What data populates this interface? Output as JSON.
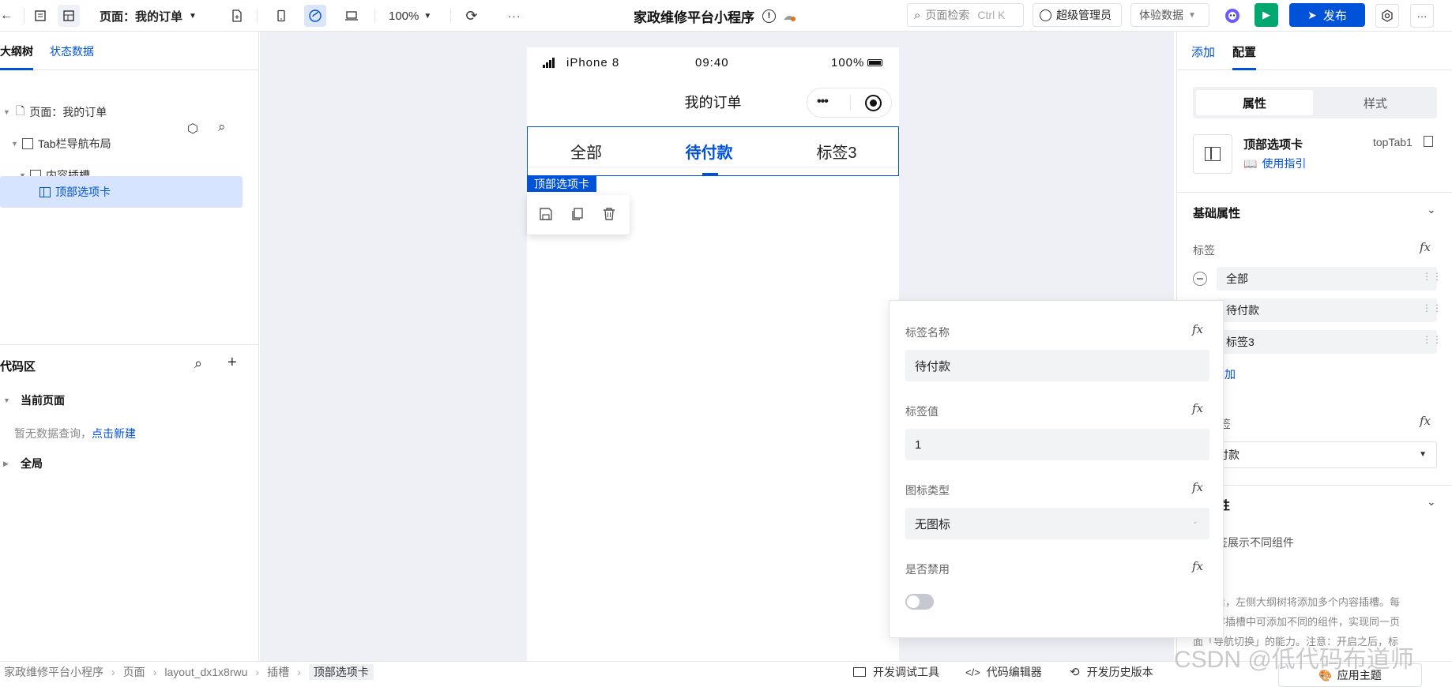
{
  "topbar": {
    "page_select": "页面：我的订单",
    "zoom": "100%",
    "more": "···",
    "app_title": "家政维修平台小程序",
    "search_placeholder": "页面检索",
    "search_shortcut": "Ctrl K",
    "user": "超级管理员",
    "data_mode": "体验数据",
    "publish": "发布"
  },
  "left": {
    "tabs": [
      "大纲树",
      "状态数据"
    ],
    "tree": [
      "页面：我的订单",
      "Tab栏导航布局",
      "内容插槽",
      "顶部选项卡"
    ],
    "code_title": "代码区",
    "current_page": "当前页面",
    "empty_text": "暂无数据查询，",
    "new_link": "点击新建",
    "global": "全局"
  },
  "phone": {
    "carrier": "iPhone 8",
    "time": "09:40",
    "battery": "100%",
    "title": "我的订单",
    "tabs": [
      "全部",
      "待付款",
      "标签3"
    ],
    "selection_label": "顶部选项卡"
  },
  "popup": {
    "name_label": "标签名称",
    "name_value": "待付款",
    "value_label": "标签值",
    "value_value": "1",
    "icon_label": "图标类型",
    "icon_value": "无图标",
    "disabled_label": "是否禁用"
  },
  "right": {
    "tabs": [
      "添加",
      "配置"
    ],
    "seg": [
      "属性",
      "样式"
    ],
    "comp_name": "顶部选项卡",
    "comp_id": "topTab1",
    "guide": "使用指引",
    "basic_section": "基础属性",
    "tags_label": "标签",
    "tag_items": [
      "全部",
      "待付款",
      "标签3"
    ],
    "add_text": "添加",
    "default_label": "标签",
    "default_value": "付款",
    "adv_section": "性",
    "adv_line": "签展示不同组件",
    "desc1": "后，左侧大纲树将添加多个内容插槽。每",
    "desc2": "容插槽中可添加不同的组件，实现同一页",
    "desc3": "面「导航切换」的能力。注意：开启之后，标",
    "apply_theme": "应用主题"
  },
  "bottom": {
    "breadcrumb": [
      "家政维修平台小程序",
      "页面",
      "layout_dx1x8rwu",
      "插槽",
      "顶部选项卡"
    ],
    "dev_tools": "开发调试工具",
    "code_editor": "代码编辑器",
    "history": "开发历史版本",
    "watermark": "CSDN @低代码布道师"
  },
  "colors": {
    "primary": "#0052d9",
    "canvas_bg": "#eef0f5",
    "publish_bg": "#0052d9",
    "run_bg": "#00a870"
  }
}
